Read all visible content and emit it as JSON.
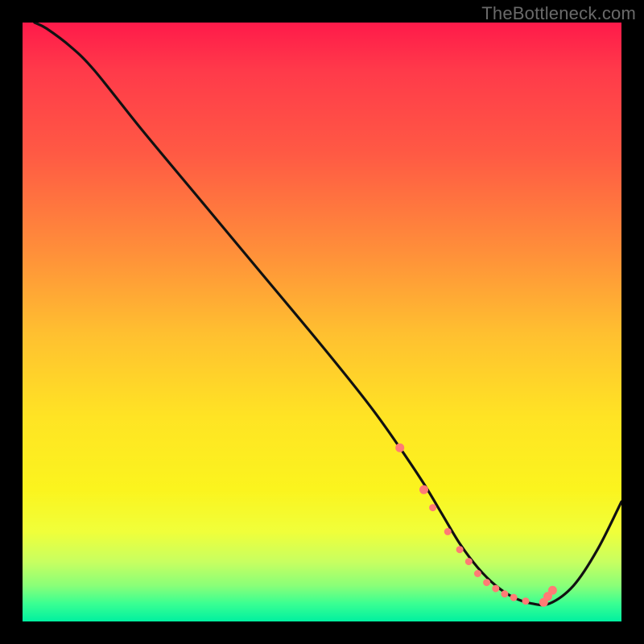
{
  "watermark": "TheBottleneck.com",
  "chart_data": {
    "type": "line",
    "title": "",
    "xlabel": "",
    "ylabel": "",
    "xlim": [
      0,
      100
    ],
    "ylim": [
      0,
      100
    ],
    "series": [
      {
        "name": "curve",
        "x": [
          2,
          4,
          8,
          12,
          20,
          30,
          40,
          50,
          58,
          63,
          67,
          70,
          73,
          76,
          79,
          82,
          85,
          88,
          92,
          96,
          100
        ],
        "y": [
          100,
          99,
          96,
          92,
          82,
          70,
          58,
          46,
          36,
          29,
          23,
          18,
          13,
          9,
          6,
          4,
          3,
          3,
          6,
          12,
          20
        ]
      }
    ],
    "markers": {
      "name": "valley-dots",
      "x": [
        63,
        67,
        68.5,
        71,
        73,
        74.5,
        76,
        77.5,
        79,
        80.5,
        82,
        84,
        87,
        87.7,
        88.5
      ],
      "y": [
        29,
        22,
        19,
        15,
        12,
        10,
        8,
        6.5,
        5.5,
        4.6,
        4,
        3.4,
        3.2,
        4.2,
        5.2
      ],
      "r": [
        5,
        5,
        4,
        4,
        4,
        4,
        4,
        4,
        4,
        4,
        4,
        4,
        5,
        5,
        5
      ]
    },
    "gradient_stops": [
      {
        "pos": 0,
        "color": "#ff1a4a"
      },
      {
        "pos": 8,
        "color": "#ff3a4a"
      },
      {
        "pos": 22,
        "color": "#ff5a44"
      },
      {
        "pos": 38,
        "color": "#ff8e3a"
      },
      {
        "pos": 52,
        "color": "#ffc030"
      },
      {
        "pos": 66,
        "color": "#ffe424"
      },
      {
        "pos": 78,
        "color": "#fbf41e"
      },
      {
        "pos": 85,
        "color": "#f0ff3a"
      },
      {
        "pos": 90,
        "color": "#c8ff60"
      },
      {
        "pos": 94,
        "color": "#8aff78"
      },
      {
        "pos": 97,
        "color": "#3aff92"
      },
      {
        "pos": 100,
        "color": "#00f0a0"
      }
    ]
  }
}
